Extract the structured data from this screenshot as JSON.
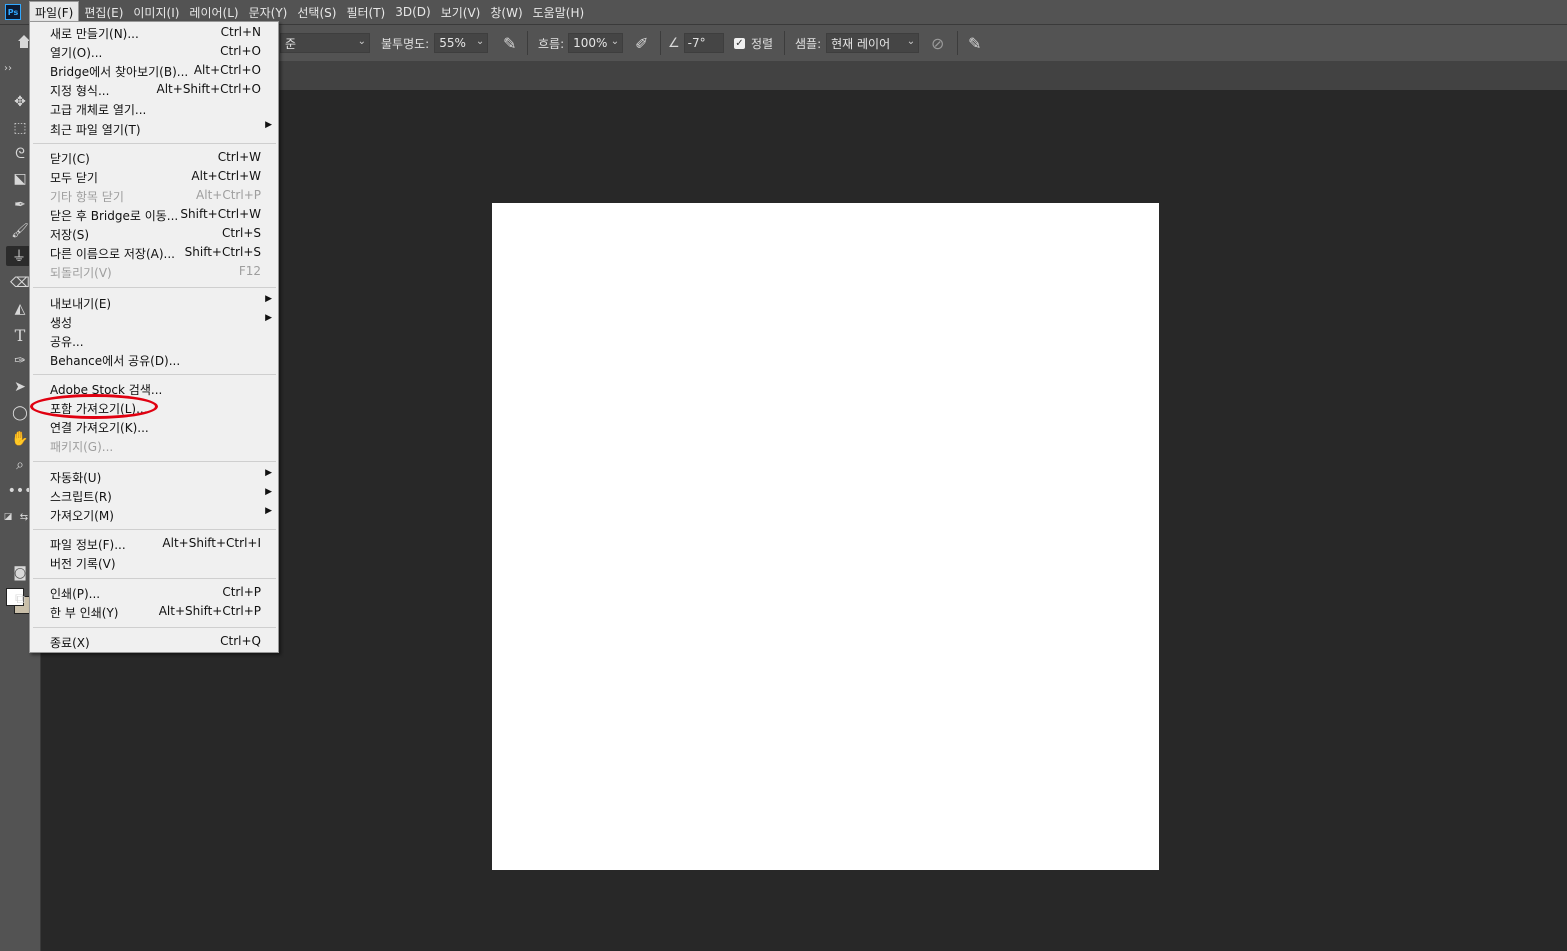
{
  "menubar": {
    "logo": "Ps",
    "items": [
      "파일(F)",
      "편집(E)",
      "이미지(I)",
      "레이어(L)",
      "문자(Y)",
      "선택(S)",
      "필터(T)",
      "3D(D)",
      "보기(V)",
      "창(W)",
      "도움말(H)"
    ],
    "active_index": 0
  },
  "options": {
    "mode_value": "준",
    "opacity_label": "불투명도:",
    "opacity_value": "55%",
    "flow_label": "흐름:",
    "flow_value": "100%",
    "angle_value": "-7°",
    "align_label": "정렬",
    "align_checked": true,
    "sample_label": "샘플:",
    "sample_value": "현재 레이어"
  },
  "toolbar": {
    "tools": [
      "move-tool-icon",
      "marquee-tool-icon",
      "lasso-tool-icon",
      "object-select-tool-icon",
      "eyedropper-tool-icon",
      "brush-tool-icon",
      "clone-stamp-tool-icon",
      "eraser-tool-icon",
      "gradient-tool-icon",
      "type-tool-icon",
      "pen-tool-icon",
      "path-select-tool-icon",
      "ellipse-tool-icon",
      "hand-tool-icon",
      "zoom-tool-icon",
      "more-tools-icon"
    ],
    "selected": "clone-stamp-tool-icon",
    "foreground_color": "#ffffff",
    "background_color": "#c9bfa9"
  },
  "file_menu": {
    "items": [
      {
        "label": "새로 만들기(N)...",
        "shortcut": "Ctrl+N"
      },
      {
        "label": "열기(O)...",
        "shortcut": "Ctrl+O"
      },
      {
        "label": "Bridge에서 찾아보기(B)...",
        "shortcut": "Alt+Ctrl+O"
      },
      {
        "label": "지정 형식...",
        "shortcut": "Alt+Shift+Ctrl+O"
      },
      {
        "label": "고급 개체로 열기...",
        "shortcut": ""
      },
      {
        "label": "최근 파일 열기(T)",
        "shortcut": "",
        "submenu": true
      },
      {
        "label": "닫기(C)",
        "shortcut": "Ctrl+W"
      },
      {
        "label": "모두 닫기",
        "shortcut": "Alt+Ctrl+W"
      },
      {
        "label": "기타 항목 닫기",
        "shortcut": "Alt+Ctrl+P",
        "disabled": true
      },
      {
        "label": "닫은 후 Bridge로 이동...",
        "shortcut": "Shift+Ctrl+W"
      },
      {
        "label": "저장(S)",
        "shortcut": "Ctrl+S"
      },
      {
        "label": "다른 이름으로 저장(A)...",
        "shortcut": "Shift+Ctrl+S"
      },
      {
        "label": "되돌리기(V)",
        "shortcut": "F12",
        "disabled": true
      },
      {
        "label": "내보내기(E)",
        "shortcut": "",
        "submenu": true
      },
      {
        "label": "생성",
        "shortcut": "",
        "submenu": true
      },
      {
        "label": "공유...",
        "shortcut": ""
      },
      {
        "label": "Behance에서 공유(D)...",
        "shortcut": ""
      },
      {
        "label": "Adobe Stock 검색...",
        "shortcut": ""
      },
      {
        "label": "포함 가져오기(L)...",
        "shortcut": "",
        "highlighted": true
      },
      {
        "label": "연결 가져오기(K)...",
        "shortcut": ""
      },
      {
        "label": "패키지(G)...",
        "shortcut": "",
        "disabled": true
      },
      {
        "label": "자동화(U)",
        "shortcut": "",
        "submenu": true
      },
      {
        "label": "스크립트(R)",
        "shortcut": "",
        "submenu": true
      },
      {
        "label": "가져오기(M)",
        "shortcut": "",
        "submenu": true
      },
      {
        "label": "파일 정보(F)...",
        "shortcut": "Alt+Shift+Ctrl+I"
      },
      {
        "label": "버전 기록(V)",
        "shortcut": ""
      },
      {
        "label": "인쇄(P)...",
        "shortcut": "Ctrl+P"
      },
      {
        "label": "한 부 인쇄(Y)",
        "shortcut": "Alt+Shift+Ctrl+P"
      },
      {
        "label": "종료(X)",
        "shortcut": "Ctrl+Q"
      }
    ],
    "highlight_color": "#e00010"
  }
}
